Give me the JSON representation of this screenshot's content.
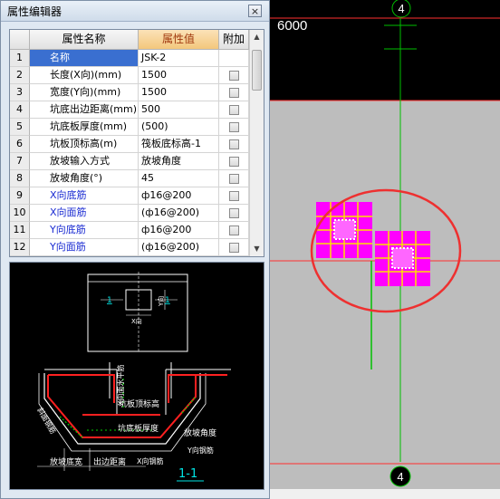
{
  "cad": {
    "axis_top_label": "4",
    "axis_bottom_label": "4",
    "dimension_label": "6000"
  },
  "editor": {
    "title": "属性编辑器",
    "close_label": "×",
    "columns": {
      "index": "",
      "name": "属性名称",
      "value": "属性值",
      "extra": "附加"
    },
    "rows": [
      {
        "index": "1",
        "name": "名称",
        "value": "JSK-2",
        "extra": false,
        "selected": true
      },
      {
        "index": "2",
        "name": "长度(X向)(mm)",
        "value": "1500",
        "extra": true
      },
      {
        "index": "3",
        "name": "宽度(Y向)(mm)",
        "value": "1500",
        "extra": true
      },
      {
        "index": "4",
        "name": "坑底出边距离(mm)",
        "value": "500",
        "extra": true
      },
      {
        "index": "5",
        "name": "坑底板厚度(mm)",
        "value": "(500)",
        "extra": true
      },
      {
        "index": "6",
        "name": "坑板顶标高(m)",
        "value": "筏板底标高-1",
        "extra": true
      },
      {
        "index": "7",
        "name": "放坡输入方式",
        "value": "放坡角度",
        "extra": true
      },
      {
        "index": "8",
        "name": "放坡角度(°)",
        "value": "45",
        "extra": true
      },
      {
        "index": "9",
        "name": "X向底筋",
        "value": "ф16@200",
        "extra": true,
        "blue": true
      },
      {
        "index": "10",
        "name": "X向面筋",
        "value": "(ф16@200)",
        "extra": true,
        "blue": true
      },
      {
        "index": "11",
        "name": "Y向底筋",
        "value": "ф16@200",
        "extra": true,
        "blue": true
      },
      {
        "index": "12",
        "name": "Y向面筋",
        "value": "(ф16@200)",
        "extra": true,
        "blue": true
      }
    ]
  },
  "diagram": {
    "plan_tag_left": "1",
    "plan_tag_right": "1",
    "y_label": "Y向",
    "x_label": "X向",
    "side_label": "X向面水平筋",
    "top_elev_label": "坑板顶标高",
    "thickness_label": "坑底板厚度",
    "slope_angle_label": "放坡角度",
    "slope_label": "斜面钢筋",
    "y_rebar_label": "Y向钢筋",
    "x_rebar_label": "X向钢筋",
    "bottom_width_label": "放坡底宽",
    "edge_distance_label": "出边距离",
    "section_label": "1-1"
  },
  "colors": {
    "panel_bg": "#dfe8f2",
    "selection": "#3a6fd0",
    "value_header": "#f3c77c",
    "magenta": "#ff00ff",
    "grid_red": "#ff3030",
    "axis_green": "#00c000",
    "cad_bg": "#bdbdbd"
  }
}
